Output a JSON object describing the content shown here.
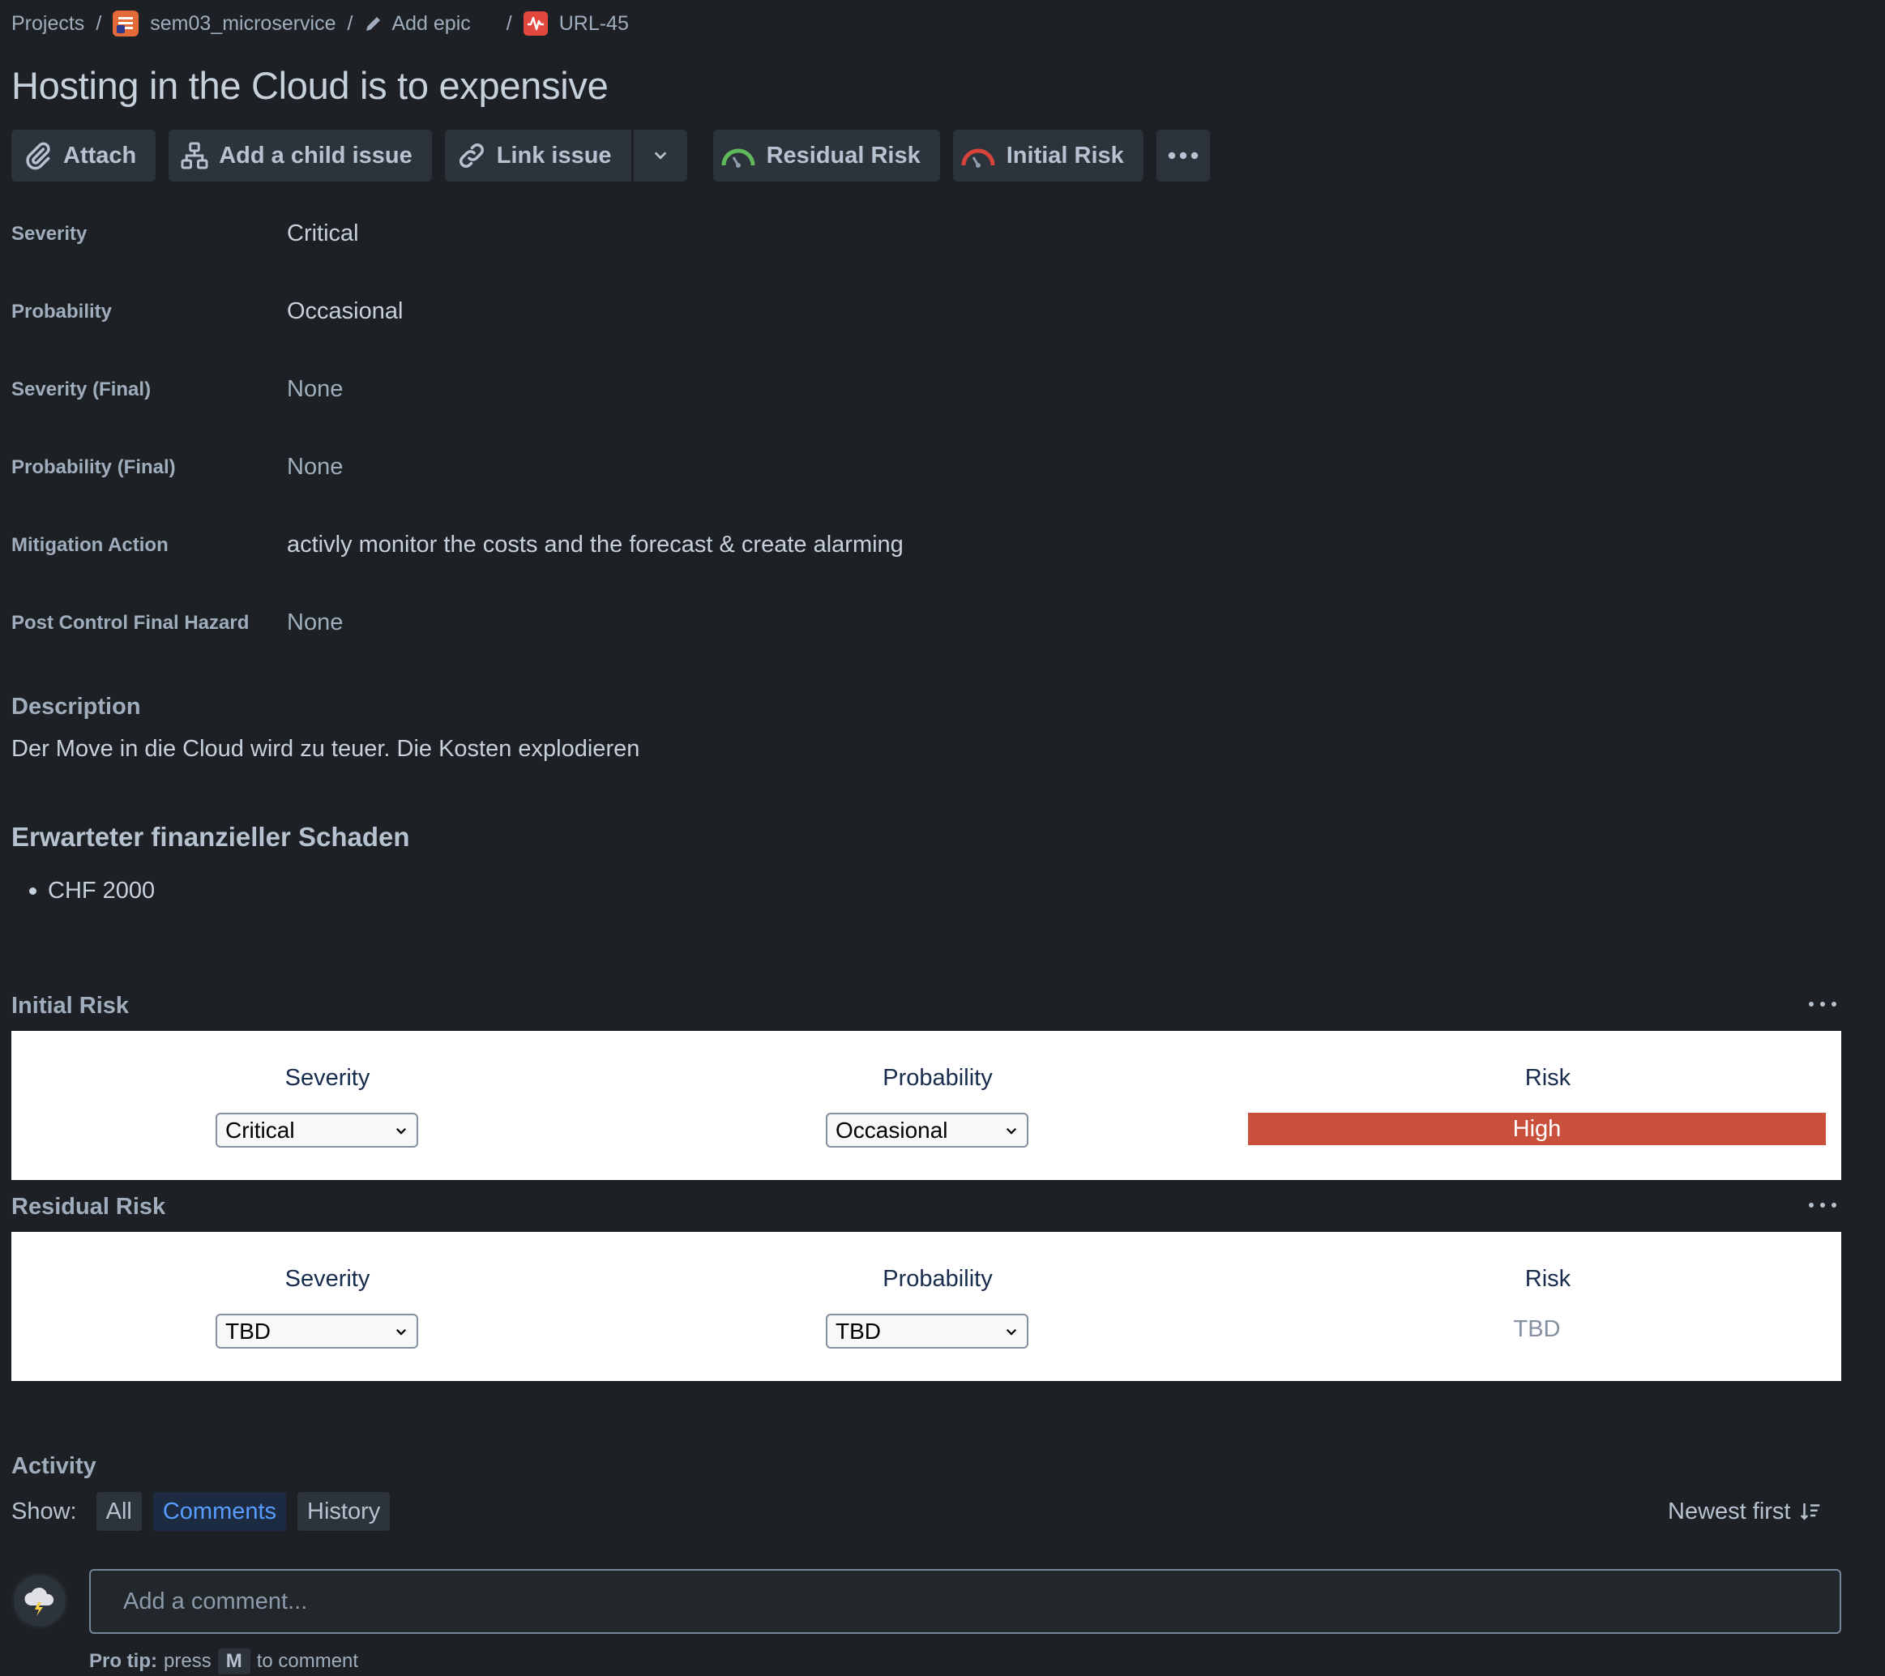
{
  "breadcrumb": {
    "projects": "Projects",
    "project": "sem03_microservice",
    "epic": "Add epic",
    "issue_key": "URL-45",
    "separator": "/"
  },
  "issue": {
    "title": "Hosting in the Cloud is to expensive"
  },
  "toolbar": {
    "attach": "Attach",
    "add_child": "Add a child issue",
    "link_issue": "Link issue",
    "residual_risk": "Residual Risk",
    "initial_risk": "Initial Risk"
  },
  "fields": [
    {
      "label": "Severity",
      "value": "Critical"
    },
    {
      "label": "Probability",
      "value": "Occasional"
    },
    {
      "label": "Severity (Final)",
      "value": "None"
    },
    {
      "label": "Probability (Final)",
      "value": "None"
    },
    {
      "label": "Mitigation Action",
      "value": "activly monitor the costs and the forecast & create alarming"
    },
    {
      "label": "Post Control Final Hazard",
      "value": "None"
    }
  ],
  "description": {
    "heading": "Description",
    "text": "Der Move in die Cloud wird zu teuer. Die Kosten explodieren",
    "subheading": "Erwarteter finanzieller Schaden",
    "bullets": [
      "CHF 2000"
    ]
  },
  "initial_risk": {
    "title": "Initial Risk",
    "severity_label": "Severity",
    "probability_label": "Probability",
    "risk_label": "Risk",
    "severity_value": "Critical",
    "probability_value": "Occasional",
    "risk_value": "High",
    "risk_color": "#c9503a"
  },
  "residual_risk": {
    "title": "Residual Risk",
    "severity_label": "Severity",
    "probability_label": "Probability",
    "risk_label": "Risk",
    "severity_value": "TBD",
    "probability_value": "TBD",
    "risk_value": "TBD"
  },
  "activity": {
    "heading": "Activity",
    "show_label": "Show:",
    "filters": [
      "All",
      "Comments",
      "History"
    ],
    "active_filter": "Comments",
    "sort": "Newest first",
    "comment_placeholder": "Add a comment...",
    "pro_tip_label": "Pro tip:",
    "pro_tip_press": "press",
    "pro_tip_key": "M",
    "pro_tip_suffix": "to comment"
  },
  "colors": {
    "background": "#1d2125",
    "accent": "#579dff",
    "risk_high": "#c9503a"
  },
  "icons": {
    "project": "project-icon",
    "issue_type": "risk-issue-icon",
    "attach": "paperclip-icon",
    "child": "hierarchy-icon",
    "link": "link-icon",
    "gauge": "gauge-icon",
    "more": "more-icon"
  }
}
